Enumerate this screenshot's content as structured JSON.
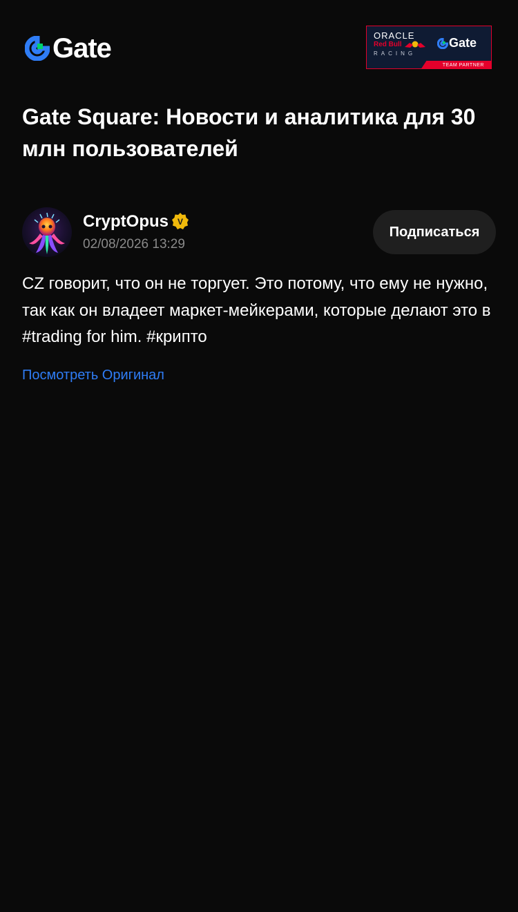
{
  "header": {
    "logo_text": "Gate",
    "partner_badge": {
      "oracle": "ORACLE",
      "redbull": "Red Bull",
      "racing": "RACING",
      "gate": "Gate",
      "stripe_label": "TEAM PARTNER"
    }
  },
  "page_title": "Gate Square: Новости и аналитика для 30 млн пользователей",
  "post": {
    "author": {
      "name": "CryptOpus",
      "verified_badge": "V",
      "timestamp": "02/08/2026 13:29"
    },
    "follow_label": "Подписаться",
    "body_text": "CZ говорит, что он не торгует. Это потому, что ему не нужно, так как он владеет маркет-мейкерами, которые делают это в ",
    "hashtag_1": "#trading",
    "body_mid": " for him. ",
    "hashtag_2": "#крипто",
    "view_original_label": "Посмотреть Оригинал"
  },
  "colors": {
    "background": "#0a0a0a",
    "accent_blue": "#2f7df6",
    "logo_green": "#00d26a",
    "verified_gold": "#f0b90b",
    "muted_text": "#8a8a8a",
    "button_bg": "#1f1f1f",
    "redbull_red": "#e4002b"
  }
}
